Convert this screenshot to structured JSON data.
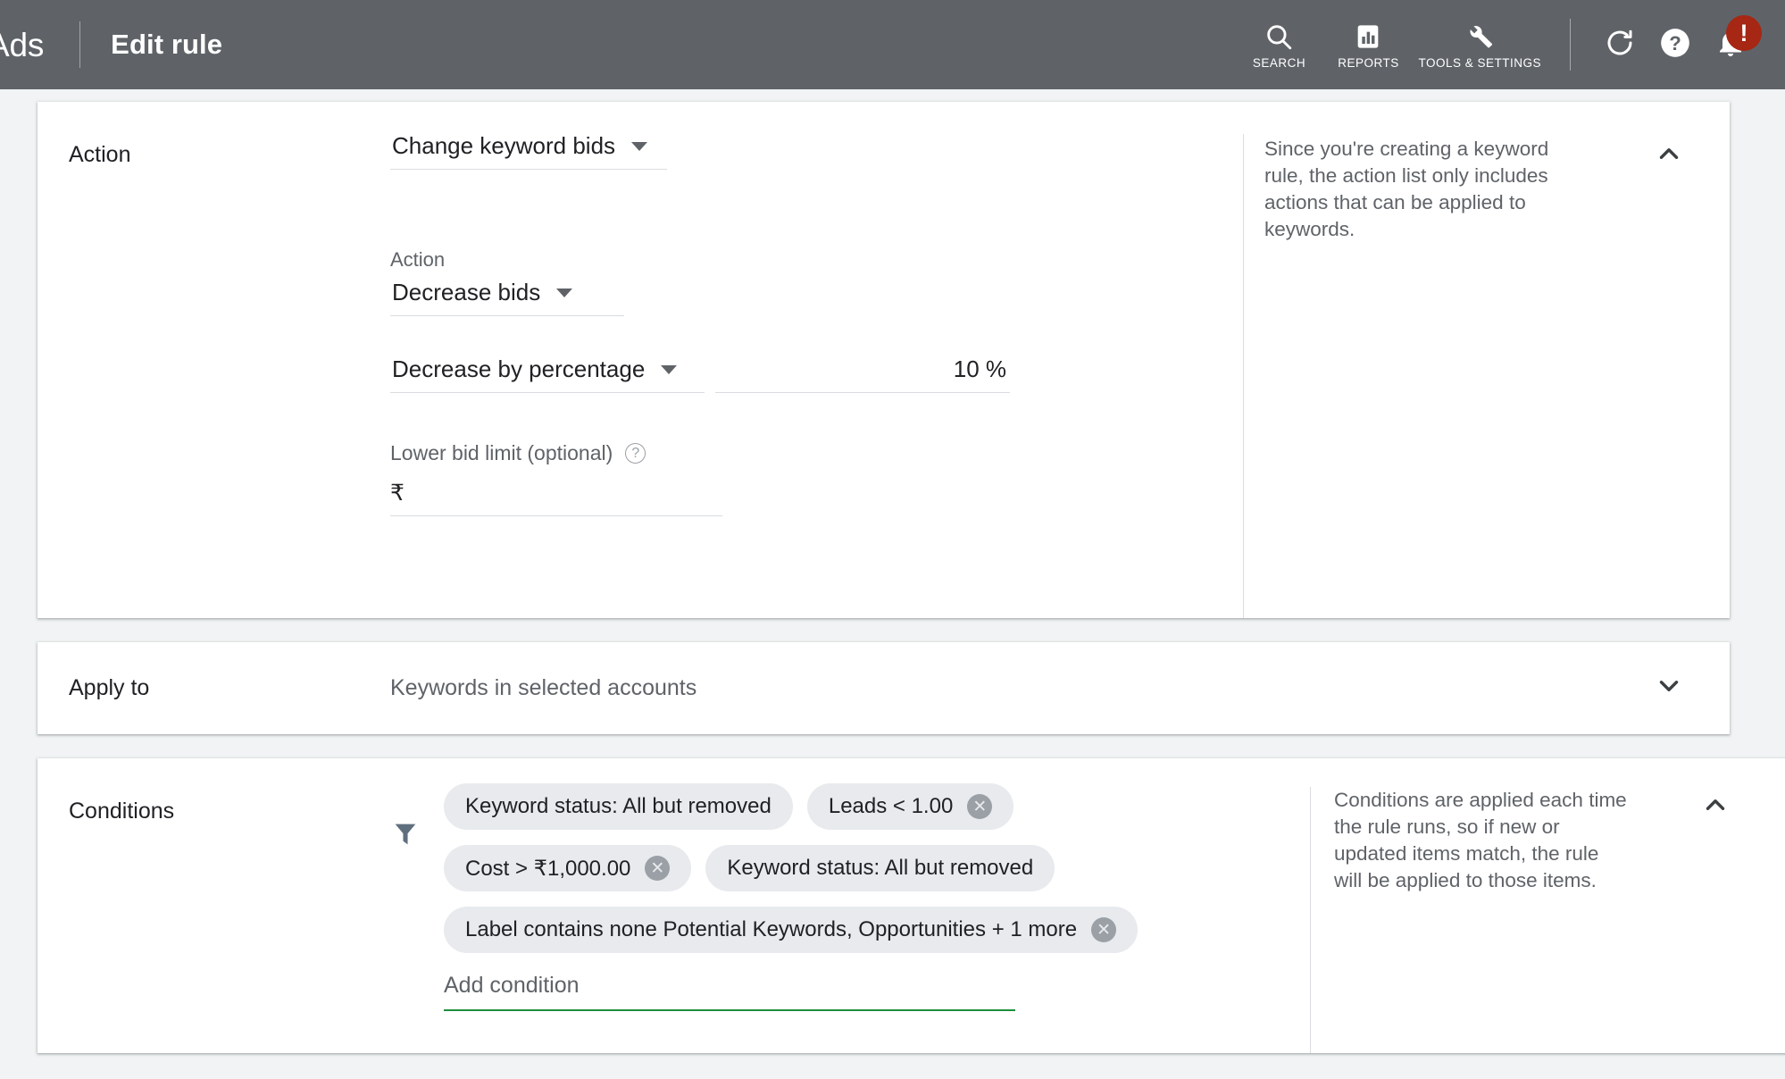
{
  "appbar": {
    "brand": "Ads",
    "page_title": "Edit rule",
    "items": [
      {
        "icon": "search-icon",
        "label": "SEARCH"
      },
      {
        "icon": "reports-icon",
        "label": "REPORTS"
      },
      {
        "icon": "tools-settings-icon",
        "label": "TOOLS &\nSETTINGS"
      }
    ],
    "refresh_icon": "refresh-icon",
    "help_icon": "help-icon",
    "notifications_icon": "notifications-bell-icon",
    "notification_badge": "!",
    "badge_color": "#a52714",
    "bar_color": "#5f6368"
  },
  "action_card": {
    "label": "Action",
    "action_type": "Change keyword bids",
    "sub_action_label": "Action",
    "sub_action_value": "Decrease bids",
    "amount_mode": "Decrease by percentage",
    "amount_value": "10 %",
    "lower_bid_limit_label": "Lower bid limit (optional)",
    "lower_bid_limit_value": "₹",
    "note": "Since you're creating a keyword rule, the action list only includes actions that can be applied to keywords.",
    "collapse_icon": "chevron-up-icon"
  },
  "apply_to_card": {
    "label": "Apply to",
    "value": "Keywords in selected accounts",
    "expand_icon": "chevron-down-icon"
  },
  "conditions_card": {
    "label": "Conditions",
    "filter_icon": "filter-funnel-icon",
    "chip_rows": [
      [
        {
          "text": "Keyword status: All but removed",
          "removable": false
        },
        {
          "text": "Leads < 1.00",
          "removable": true
        }
      ],
      [
        {
          "text": "Cost > ₹1,000.00",
          "removable": true
        },
        {
          "text": "Keyword status: All but removed",
          "removable": false
        }
      ],
      [
        {
          "text": "Label contains none Potential Keywords, Opportunities + 1 more",
          "removable": true
        }
      ]
    ],
    "add_condition_placeholder": "Add condition",
    "add_condition_underline_color": "#1e8e3e",
    "note": "Conditions are applied each time the rule runs, so if new or updated items match, the rule will be applied to those items.",
    "collapse_icon": "chevron-up-icon"
  }
}
